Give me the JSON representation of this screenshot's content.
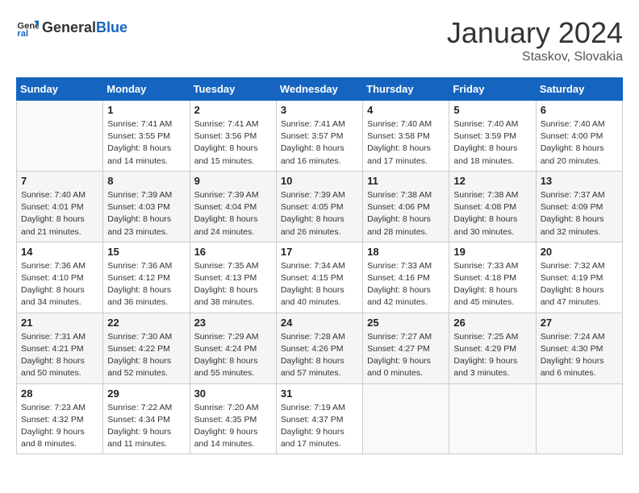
{
  "header": {
    "logo_general": "General",
    "logo_blue": "Blue",
    "title": "January 2024",
    "subtitle": "Staskov, Slovakia"
  },
  "columns": [
    "Sunday",
    "Monday",
    "Tuesday",
    "Wednesday",
    "Thursday",
    "Friday",
    "Saturday"
  ],
  "weeks": [
    [
      {
        "day": "",
        "info": ""
      },
      {
        "day": "1",
        "info": "Sunrise: 7:41 AM\nSunset: 3:55 PM\nDaylight: 8 hours\nand 14 minutes."
      },
      {
        "day": "2",
        "info": "Sunrise: 7:41 AM\nSunset: 3:56 PM\nDaylight: 8 hours\nand 15 minutes."
      },
      {
        "day": "3",
        "info": "Sunrise: 7:41 AM\nSunset: 3:57 PM\nDaylight: 8 hours\nand 16 minutes."
      },
      {
        "day": "4",
        "info": "Sunrise: 7:40 AM\nSunset: 3:58 PM\nDaylight: 8 hours\nand 17 minutes."
      },
      {
        "day": "5",
        "info": "Sunrise: 7:40 AM\nSunset: 3:59 PM\nDaylight: 8 hours\nand 18 minutes."
      },
      {
        "day": "6",
        "info": "Sunrise: 7:40 AM\nSunset: 4:00 PM\nDaylight: 8 hours\nand 20 minutes."
      }
    ],
    [
      {
        "day": "7",
        "info": "Sunrise: 7:40 AM\nSunset: 4:01 PM\nDaylight: 8 hours\nand 21 minutes."
      },
      {
        "day": "8",
        "info": "Sunrise: 7:39 AM\nSunset: 4:03 PM\nDaylight: 8 hours\nand 23 minutes."
      },
      {
        "day": "9",
        "info": "Sunrise: 7:39 AM\nSunset: 4:04 PM\nDaylight: 8 hours\nand 24 minutes."
      },
      {
        "day": "10",
        "info": "Sunrise: 7:39 AM\nSunset: 4:05 PM\nDaylight: 8 hours\nand 26 minutes."
      },
      {
        "day": "11",
        "info": "Sunrise: 7:38 AM\nSunset: 4:06 PM\nDaylight: 8 hours\nand 28 minutes."
      },
      {
        "day": "12",
        "info": "Sunrise: 7:38 AM\nSunset: 4:08 PM\nDaylight: 8 hours\nand 30 minutes."
      },
      {
        "day": "13",
        "info": "Sunrise: 7:37 AM\nSunset: 4:09 PM\nDaylight: 8 hours\nand 32 minutes."
      }
    ],
    [
      {
        "day": "14",
        "info": "Sunrise: 7:36 AM\nSunset: 4:10 PM\nDaylight: 8 hours\nand 34 minutes."
      },
      {
        "day": "15",
        "info": "Sunrise: 7:36 AM\nSunset: 4:12 PM\nDaylight: 8 hours\nand 36 minutes."
      },
      {
        "day": "16",
        "info": "Sunrise: 7:35 AM\nSunset: 4:13 PM\nDaylight: 8 hours\nand 38 minutes."
      },
      {
        "day": "17",
        "info": "Sunrise: 7:34 AM\nSunset: 4:15 PM\nDaylight: 8 hours\nand 40 minutes."
      },
      {
        "day": "18",
        "info": "Sunrise: 7:33 AM\nSunset: 4:16 PM\nDaylight: 8 hours\nand 42 minutes."
      },
      {
        "day": "19",
        "info": "Sunrise: 7:33 AM\nSunset: 4:18 PM\nDaylight: 8 hours\nand 45 minutes."
      },
      {
        "day": "20",
        "info": "Sunrise: 7:32 AM\nSunset: 4:19 PM\nDaylight: 8 hours\nand 47 minutes."
      }
    ],
    [
      {
        "day": "21",
        "info": "Sunrise: 7:31 AM\nSunset: 4:21 PM\nDaylight: 8 hours\nand 50 minutes."
      },
      {
        "day": "22",
        "info": "Sunrise: 7:30 AM\nSunset: 4:22 PM\nDaylight: 8 hours\nand 52 minutes."
      },
      {
        "day": "23",
        "info": "Sunrise: 7:29 AM\nSunset: 4:24 PM\nDaylight: 8 hours\nand 55 minutes."
      },
      {
        "day": "24",
        "info": "Sunrise: 7:28 AM\nSunset: 4:26 PM\nDaylight: 8 hours\nand 57 minutes."
      },
      {
        "day": "25",
        "info": "Sunrise: 7:27 AM\nSunset: 4:27 PM\nDaylight: 9 hours\nand 0 minutes."
      },
      {
        "day": "26",
        "info": "Sunrise: 7:25 AM\nSunset: 4:29 PM\nDaylight: 9 hours\nand 3 minutes."
      },
      {
        "day": "27",
        "info": "Sunrise: 7:24 AM\nSunset: 4:30 PM\nDaylight: 9 hours\nand 6 minutes."
      }
    ],
    [
      {
        "day": "28",
        "info": "Sunrise: 7:23 AM\nSunset: 4:32 PM\nDaylight: 9 hours\nand 8 minutes."
      },
      {
        "day": "29",
        "info": "Sunrise: 7:22 AM\nSunset: 4:34 PM\nDaylight: 9 hours\nand 11 minutes."
      },
      {
        "day": "30",
        "info": "Sunrise: 7:20 AM\nSunset: 4:35 PM\nDaylight: 9 hours\nand 14 minutes."
      },
      {
        "day": "31",
        "info": "Sunrise: 7:19 AM\nSunset: 4:37 PM\nDaylight: 9 hours\nand 17 minutes."
      },
      {
        "day": "",
        "info": ""
      },
      {
        "day": "",
        "info": ""
      },
      {
        "day": "",
        "info": ""
      }
    ]
  ]
}
